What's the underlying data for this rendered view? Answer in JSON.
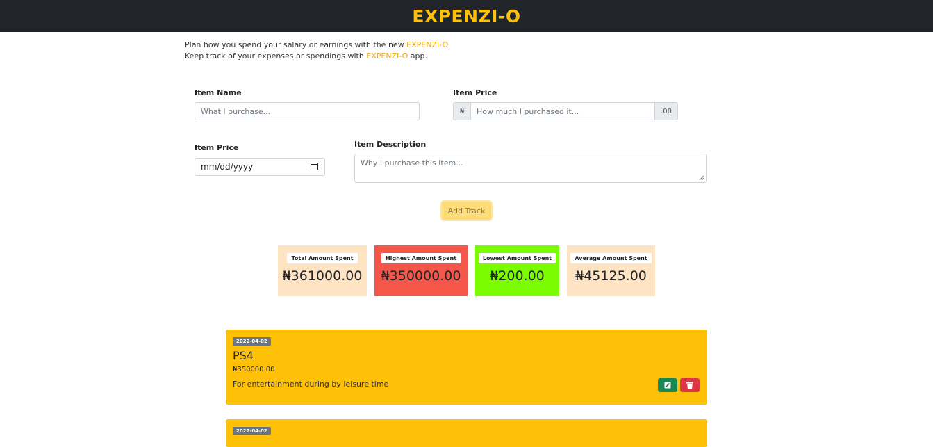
{
  "header": {
    "brand": "EXPENZI-O"
  },
  "intro": {
    "line1_prefix": "Plan how you spend your salary or earnings with the new ",
    "line1_brand": "EXPENZI-O",
    "line1_suffix": ".",
    "line2_prefix": "Keep track of your expenses or spendings with ",
    "line2_brand": "EXPENZI-O",
    "line2_suffix": " app."
  },
  "form": {
    "item_name_label": "Item Name",
    "item_name_placeholder": "What I purchase...",
    "item_price_label": "Item Price",
    "currency_symbol": "₦",
    "item_price_placeholder": "How much I purchased it...",
    "decimal_suffix": ".00",
    "date_label": "Item Price",
    "date_placeholder": "mm/dd/yyyy",
    "description_label": "Item Description",
    "description_placeholder": "Why I purchase this Item...",
    "add_button": "Add Track"
  },
  "stats": [
    {
      "title": "Total Amount Spent",
      "value": "₦361000.00",
      "bg": "#ffe4c4"
    },
    {
      "title": "Highest Amount Spent",
      "value": "₦350000.00",
      "bg": "#f5564a"
    },
    {
      "title": "Lowest Amount Spent",
      "value": "₦200.00",
      "bg": "#7cfc00"
    },
    {
      "title": "Average Amount Spent",
      "value": "₦45125.00",
      "bg": "#ffe4c4"
    }
  ],
  "expenses": [
    {
      "date": "2022-04-02",
      "name": "PS4",
      "price": "₦350000.00",
      "description": "For entertainment during by leisure time"
    },
    {
      "date": "2022-04-02"
    }
  ],
  "colors": {
    "accent": "#ffc107",
    "navbar": "#212529",
    "edit": "#198754",
    "delete": "#dc3545"
  }
}
